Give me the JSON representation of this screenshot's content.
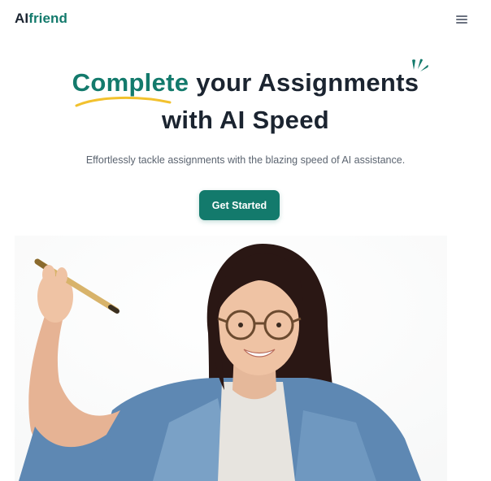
{
  "brand": {
    "ai": "AI",
    "friend": "friend"
  },
  "nav": {
    "menu_icon": "hamburger-menu-icon"
  },
  "hero": {
    "title_highlight": "Complete",
    "title_rest_line1": "your Assignments",
    "title_line2": "with AI Speed",
    "subtitle": "Effortlessly tackle assignments with the blazing speed of AI assistance.",
    "cta_label": "Get Started"
  },
  "colors": {
    "accent": "#137a6c",
    "heading": "#1b2430",
    "underline": "#f2c12e",
    "subtitle": "#5b6470"
  },
  "image": {
    "subject": "student-holding-pen-illustration"
  }
}
